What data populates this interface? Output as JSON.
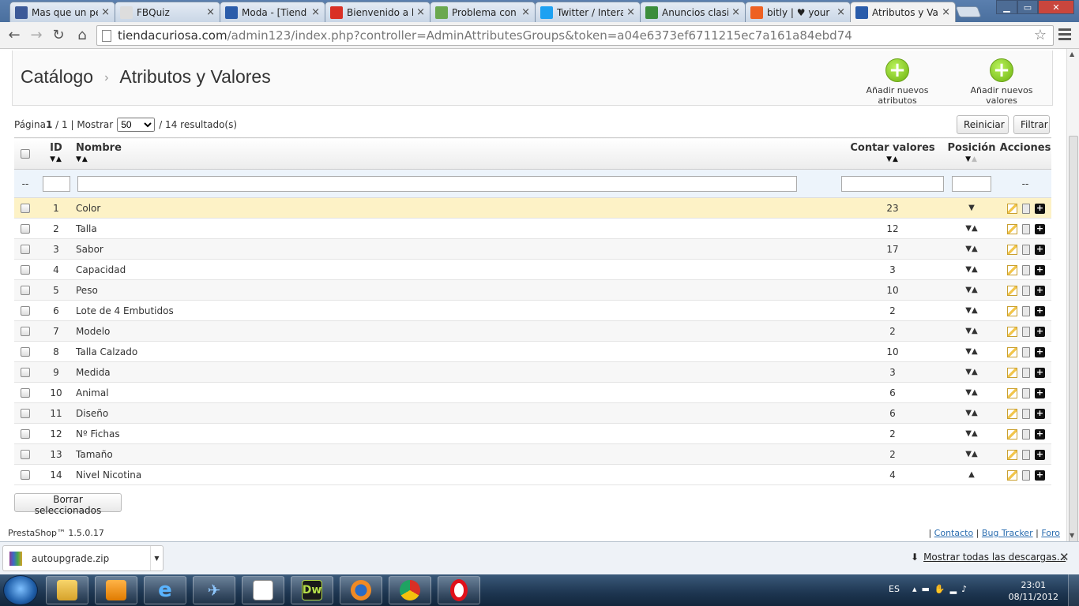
{
  "browser": {
    "tabs": [
      {
        "title": "Mas que un pe",
        "favicon_color": "#3b5998"
      },
      {
        "title": "FBQuiz",
        "favicon_color": "#dddddd"
      },
      {
        "title": "Moda - [Tiend",
        "favicon_color": "#2a5caa"
      },
      {
        "title": "Bienvenido a l",
        "favicon_color": "#d93025"
      },
      {
        "title": "Problema con",
        "favicon_color": "#6aa84f"
      },
      {
        "title": "Twitter / Intera",
        "favicon_color": "#1da1f2"
      },
      {
        "title": "Anuncios clasi",
        "favicon_color": "#3c8d3c"
      },
      {
        "title": "bitly | ♥ your b",
        "favicon_color": "#ee6123"
      },
      {
        "title": "Atributos y Val",
        "favicon_color": "#2a5caa"
      }
    ],
    "url_host": "tiendacuriosa.com",
    "url_path": "/admin123/index.php?controller=AdminAttributesGroups&token=a04e6373ef6711215ec7a161a84ebd74"
  },
  "header": {
    "breadcrumb_root": "Catálogo",
    "breadcrumb_sep": "›",
    "title": "Atributos y Valores",
    "add_attributes_label": "Añadir nuevos atributos",
    "add_values_label": "Añadir nuevos valores"
  },
  "pager": {
    "page_label": "Página",
    "page_current": "1",
    "page_total": " / 1 | Mostrar",
    "per_page": "50",
    "results": "/ 14 resultado(s)"
  },
  "buttons": {
    "reset": "Reiniciar",
    "filter": "Filtrar",
    "delete_selected": "Borrar seleccionados"
  },
  "table": {
    "columns": {
      "id": "ID",
      "name": "Nombre",
      "count": "Contar valores",
      "position": "Posición",
      "actions": "Acciones"
    },
    "filter_dash": "--",
    "rows": [
      {
        "id": "1",
        "name": "Color",
        "count": "23",
        "pos": "▼"
      },
      {
        "id": "2",
        "name": "Talla",
        "count": "12",
        "pos": "▼▲"
      },
      {
        "id": "3",
        "name": "Sabor",
        "count": "17",
        "pos": "▼▲"
      },
      {
        "id": "4",
        "name": "Capacidad",
        "count": "3",
        "pos": "▼▲"
      },
      {
        "id": "5",
        "name": "Peso",
        "count": "10",
        "pos": "▼▲"
      },
      {
        "id": "6",
        "name": "Lote de 4 Embutidos",
        "count": "2",
        "pos": "▼▲"
      },
      {
        "id": "7",
        "name": "Modelo",
        "count": "2",
        "pos": "▼▲"
      },
      {
        "id": "8",
        "name": "Talla Calzado",
        "count": "10",
        "pos": "▼▲"
      },
      {
        "id": "9",
        "name": "Medida",
        "count": "3",
        "pos": "▼▲"
      },
      {
        "id": "10",
        "name": "Animal",
        "count": "6",
        "pos": "▼▲"
      },
      {
        "id": "11",
        "name": "Diseño",
        "count": "6",
        "pos": "▼▲"
      },
      {
        "id": "12",
        "name": "Nº Fichas",
        "count": "2",
        "pos": "▼▲"
      },
      {
        "id": "13",
        "name": "Tamaño",
        "count": "2",
        "pos": "▼▲"
      },
      {
        "id": "14",
        "name": "Nivel Nicotina",
        "count": "4",
        "pos": "▲"
      }
    ]
  },
  "footer": {
    "version": "PrestaShop™ 1.5.0.17",
    "sep": "|",
    "contact": "Contacto",
    "bug_tracker": "Bug Tracker",
    "forum": "Foro"
  },
  "downloads": {
    "file": "autoupgrade.zip",
    "show_all": "Mostrar todas las descargas..."
  },
  "taskbar": {
    "lang": "ES",
    "time": "23:01",
    "date": "08/11/2012",
    "dw_label": "Dw"
  }
}
